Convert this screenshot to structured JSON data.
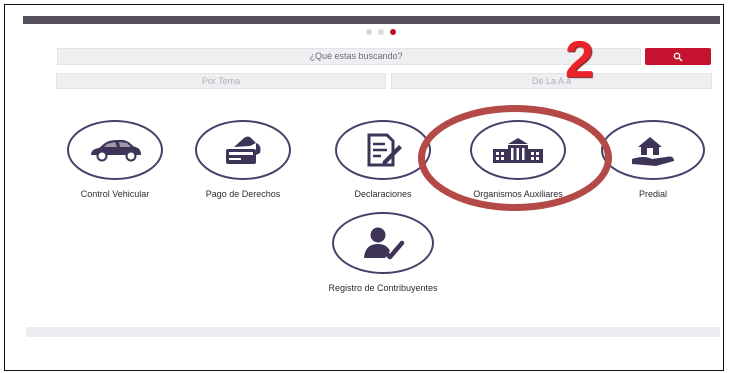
{
  "slider": {
    "total_dots": 3,
    "active_index": 2
  },
  "search": {
    "placeholder": "¿Qué estas buscando?"
  },
  "filters": {
    "by_topic": "Por Tema",
    "a_to_z": "De La A a"
  },
  "annotation": {
    "step_number": "2"
  },
  "tiles": [
    {
      "label": "Control Vehicular",
      "icon": "car-icon"
    },
    {
      "label": "Pago de Derechos",
      "icon": "payment-card-icon"
    },
    {
      "label": "Declaraciones",
      "icon": "document-edit-icon"
    },
    {
      "label": "Organismos Auxiliares",
      "icon": "government-building-icon"
    },
    {
      "label": "Predial",
      "icon": "house-in-hand-icon"
    },
    {
      "label": "Registro de Contribuyentes",
      "icon": "user-check-icon"
    }
  ],
  "colors": {
    "accent": "#c4122f",
    "icon": "#3d3458",
    "highlight_ring": "#b44a48",
    "number": "#e8232a"
  }
}
